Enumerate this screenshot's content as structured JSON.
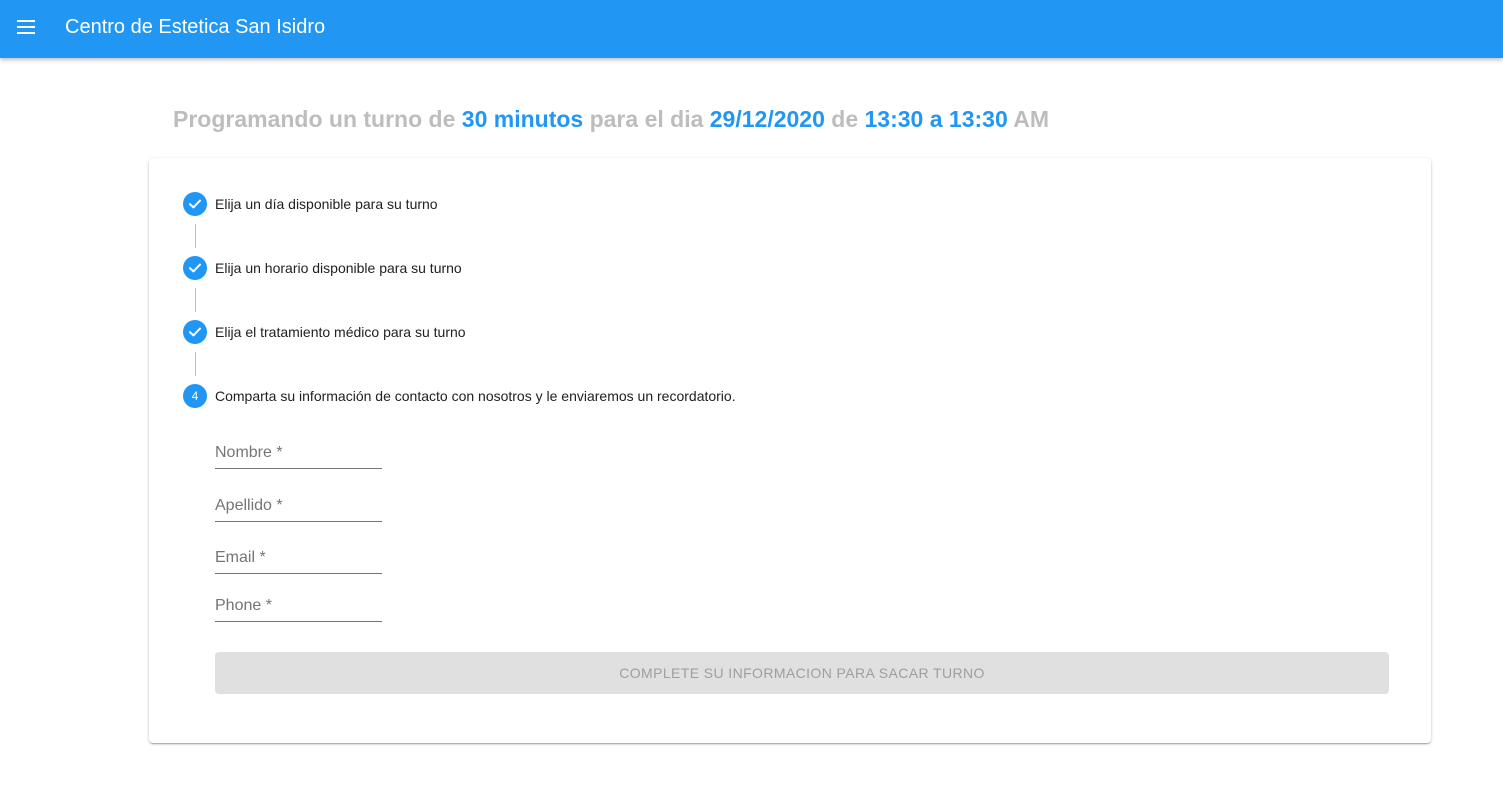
{
  "app": {
    "title": "Centro de Estetica San Isidro",
    "menu_icon": "menu-icon",
    "bar_color": "#2196f3"
  },
  "headline": {
    "part1": "Programando un turno de ",
    "duration": "30 minutos",
    "part2": " para el dia ",
    "date": "29/12/2020",
    "part3": " de ",
    "time_range": "13:30 a 13:30",
    "part4": " AM"
  },
  "steps": [
    {
      "label": "Elija un día disponible para su turno",
      "status": "completed",
      "icon": "check-icon"
    },
    {
      "label": "Elija un horario disponible para su turno",
      "status": "completed",
      "icon": "check-icon"
    },
    {
      "label": "Elija el tratamiento médico para su turno",
      "status": "completed",
      "icon": "check-icon"
    },
    {
      "label": "Comparta su información de contacto con nosotros y le enviaremos un recordatorio.",
      "status": "active",
      "number": "4"
    }
  ],
  "form": {
    "fields": [
      {
        "label": "Nombre *",
        "value": ""
      },
      {
        "label": "Apellido *",
        "value": ""
      },
      {
        "label": "Email *",
        "value": ""
      },
      {
        "label": "Phone *",
        "value": ""
      }
    ],
    "submit_label": "COMPLETE SU INFORMACION PARA SACAR TURNO",
    "submit_disabled": true
  },
  "colors": {
    "accent": "#2196f3",
    "muted_text": "#bdbdbd",
    "disabled_button": "#e0e0e0"
  }
}
